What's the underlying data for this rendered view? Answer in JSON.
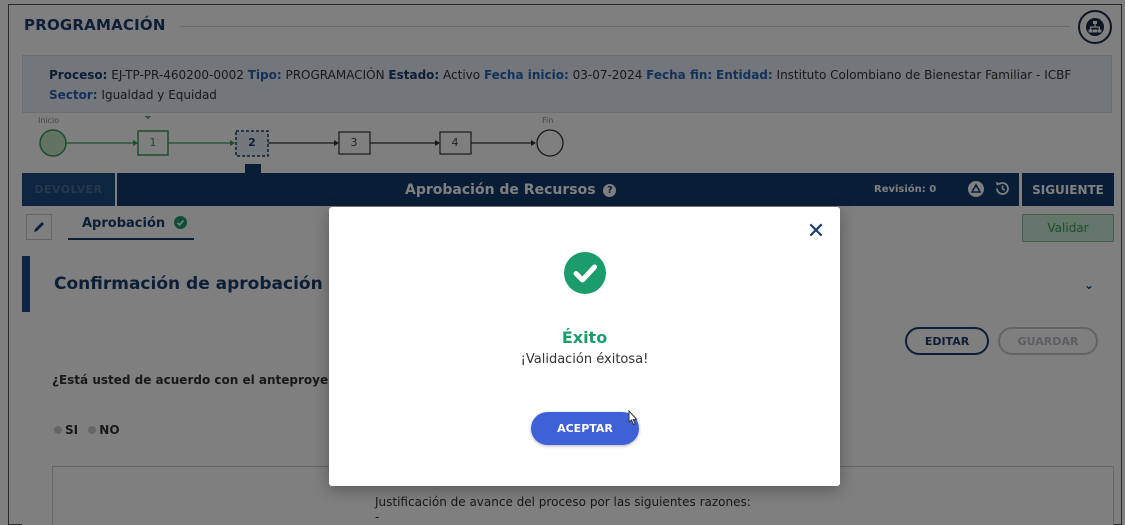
{
  "header": {
    "title": "PROGRAMACIÓN",
    "org_icon": "org-chart-icon"
  },
  "info": {
    "proceso_label": "Proceso:",
    "proceso_value": "EJ-TP-PR-460200-0002",
    "tipo_label": "Tipo:",
    "tipo_value": "PROGRAMACIÓN",
    "estado_label": "Estado:",
    "estado_value": "Activo",
    "fecha_inicio_label": "Fecha inicio:",
    "fecha_inicio_value": "03-07-2024",
    "fecha_fin_label": "Fecha fin:",
    "entidad_label": "Entidad:",
    "entidad_value": "Instituto Colombiano de Bienestar Familiar - ICBF",
    "sector_label": "Sector:",
    "sector_value": "Igualdad y Equidad"
  },
  "stepper": {
    "start_label": "Inicio",
    "end_label": "Fin",
    "steps": [
      "1",
      "2",
      "3",
      "4"
    ],
    "completed_step": "1",
    "current_step": "2"
  },
  "toolbar": {
    "devolver_label": "DEVOLVER",
    "title": "Aprobación de Recursos",
    "help_glyph": "?",
    "revision_label": "Revisión: 0",
    "siguiente_label": "SIGUIENTE"
  },
  "tabs": {
    "aprobacion_label": "Aprobación",
    "validar_label": "Validar"
  },
  "section": {
    "title": "Confirmación de aprobación",
    "editar_label": "EDITAR",
    "guardar_label": "GUARDAR",
    "question": "¿Está usted de acuerdo con el anteproye",
    "option_si": "SI",
    "option_no": "NO",
    "justification": "Justificación de avance del proceso por las siguientes razones:",
    "justification_value": "-"
  },
  "modal": {
    "close_glyph": "✕",
    "title": "Éxito",
    "message": "¡Validación éxitosa!",
    "accept_label": "ACEPTAR"
  },
  "colors": {
    "primary": "#143b6e",
    "success": "#1a9c6b",
    "accept": "#3f61d8"
  }
}
